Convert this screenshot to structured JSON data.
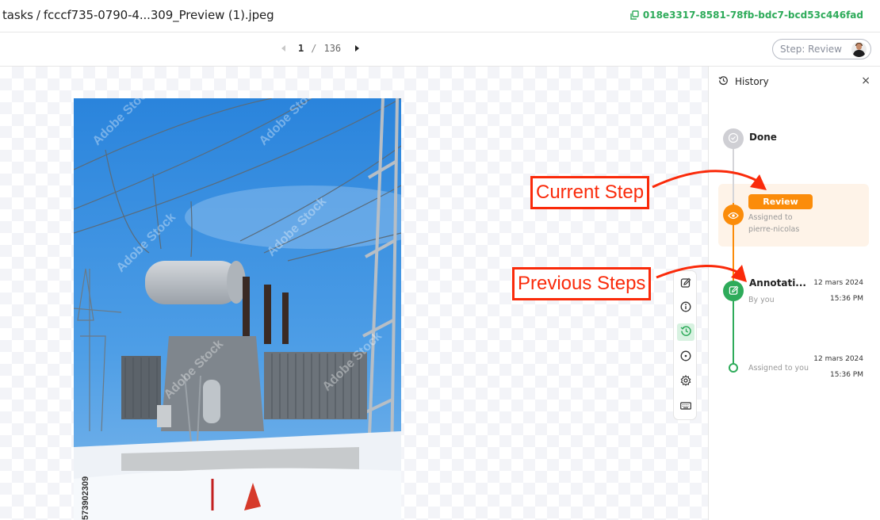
{
  "topbar": {
    "breadcrumb_root": "tasks",
    "breadcrumb_sep": "/",
    "file_name": "fcccf735-0790-4...309_Preview (1).jpeg",
    "task_id": "018e3317-8581-78fb-bdc7-bcd53c446fad",
    "copy_icon": "copy-icon"
  },
  "pager": {
    "current": "1",
    "separator": "/",
    "total": "136"
  },
  "step_pill": {
    "label": "Step: Review"
  },
  "image": {
    "watermark_text": "Adobe Stock",
    "side_id": "573902309"
  },
  "toolbar": {
    "tools": [
      {
        "icon": "edit-icon",
        "active": false
      },
      {
        "icon": "info-icon",
        "active": false
      },
      {
        "icon": "history-icon",
        "active": true
      },
      {
        "icon": "circle-dot-icon",
        "active": false
      },
      {
        "icon": "settings-icon",
        "active": false
      },
      {
        "icon": "keyboard-icon",
        "active": false
      }
    ]
  },
  "history": {
    "title": "History",
    "close_label": "×",
    "steps": [
      {
        "title": "Done",
        "status": "pending",
        "color": "#cfcfd4"
      },
      {
        "title": "Review",
        "subtitle_line1": "Assigned to",
        "subtitle_line2": "pierre-nicolas",
        "status": "current",
        "color": "#fb8c0a"
      },
      {
        "title": "Annotati...",
        "subtitle": "By you",
        "date": "12 mars 2024",
        "time": "15:36 PM",
        "status": "completed",
        "color": "#2eab5a"
      },
      {
        "title": "",
        "subtitle": "Assigned to you",
        "date": "12 mars 2024",
        "time": "15:36 PM",
        "status": "start",
        "color": "#2eab5a"
      }
    ]
  },
  "annotations": {
    "current_step": "Current Step",
    "previous_steps": "Previous Steps",
    "color": "#fa2a0a"
  }
}
